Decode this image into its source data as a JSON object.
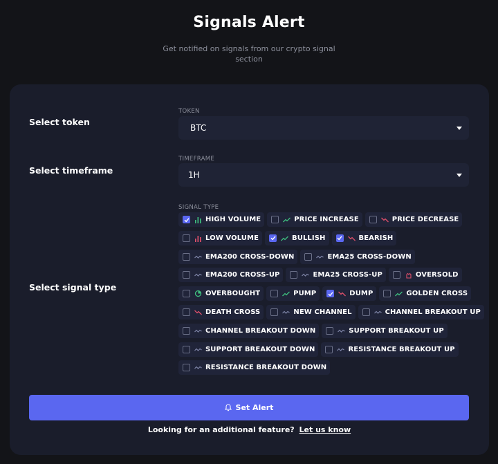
{
  "header": {
    "title": "Signals Alert",
    "subtitle": "Get notified on signals from our crypto signal section"
  },
  "form": {
    "token": {
      "row_label": "Select token",
      "field_label": "TOKEN",
      "value": "BTC"
    },
    "timeframe": {
      "row_label": "Select timeframe",
      "field_label": "TIMEFRAME",
      "value": "1H"
    },
    "signal_type": {
      "row_label": "Select signal type",
      "field_label": "SIGNAL TYPE",
      "rows": [
        [
          {
            "label": "HIGH VOLUME",
            "checked": true,
            "icon": "volume-bars-icon"
          },
          {
            "label": "PRICE INCREASE",
            "checked": false,
            "icon": "trend-up-icon"
          },
          {
            "label": "PRICE DECREASE",
            "checked": false,
            "icon": "trend-down-icon"
          }
        ],
        [
          {
            "label": "LOW VOLUME",
            "checked": false,
            "icon": "volume-bars-icon"
          },
          {
            "label": "BULLISH",
            "checked": true,
            "icon": "trend-up-icon"
          },
          {
            "label": "BEARISH",
            "checked": true,
            "icon": "trend-down-icon"
          }
        ],
        [
          {
            "label": "EMA200 CROSS-DOWN",
            "checked": false,
            "icon": "wave-icon"
          },
          {
            "label": "EMA25 CROSS-DOWN",
            "checked": false,
            "icon": "wave-icon"
          }
        ],
        [
          {
            "label": "EMA200 CROSS-UP",
            "checked": false,
            "icon": "wave-icon"
          },
          {
            "label": "EMA25 CROSS-UP",
            "checked": false,
            "icon": "wave-icon"
          },
          {
            "label": "OVERSOLD",
            "checked": false,
            "icon": "hand-icon"
          }
        ],
        [
          {
            "label": "OVERBOUGHT",
            "checked": false,
            "icon": "pie-icon"
          },
          {
            "label": "PUMP",
            "checked": false,
            "icon": "trend-up-icon"
          },
          {
            "label": "DUMP",
            "checked": true,
            "icon": "trend-down-icon"
          },
          {
            "label": "GOLDEN CROSS",
            "checked": false,
            "icon": "trend-up-icon"
          }
        ],
        [
          {
            "label": "DEATH CROSS",
            "checked": false,
            "icon": "trend-down-icon"
          },
          {
            "label": "NEW CHANNEL",
            "checked": false,
            "icon": "wave-icon"
          },
          {
            "label": "CHANNEL BREAKOUT UP",
            "checked": false,
            "icon": "wave-icon"
          }
        ],
        [
          {
            "label": "CHANNEL BREAKOUT DOWN",
            "checked": false,
            "icon": "wave-icon"
          },
          {
            "label": "SUPPORT BREAKOUT UP",
            "checked": false,
            "icon": "wave-icon"
          }
        ],
        [
          {
            "label": "SUPPORT BREAKOUT DOWN",
            "checked": false,
            "icon": "wave-icon"
          },
          {
            "label": "RESISTANCE BREAKOUT UP",
            "checked": false,
            "icon": "wave-icon"
          }
        ],
        [
          {
            "label": "RESISTANCE BREAKOUT DOWN",
            "checked": false,
            "icon": "wave-icon"
          }
        ]
      ]
    },
    "submit_label": "Set Alert",
    "footer_text": "Looking for an additional feature?",
    "footer_link": "Let us know"
  },
  "colors": {
    "accent": "#5a67f0",
    "up": "#3fbf7f",
    "down": "#e0506b",
    "neutral": "#7f86a8",
    "volume_high": "#3fbf7f",
    "volume_low": "#e0506b"
  }
}
